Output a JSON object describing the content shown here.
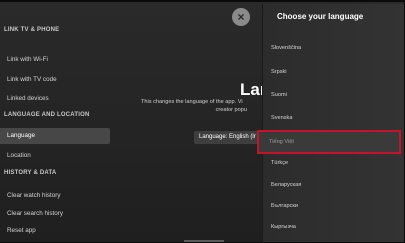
{
  "sidebar": {
    "items": [
      {
        "label": "LINK TV & PHONE",
        "type": "header"
      },
      {
        "label": "Link with Wi-Fi",
        "type": "item"
      },
      {
        "label": "Link with TV code",
        "type": "item"
      },
      {
        "label": "Linked devices",
        "type": "item"
      },
      {
        "label": "LANGUAGE AND LOCATION",
        "type": "header"
      },
      {
        "label": "Language",
        "type": "item",
        "active": true
      },
      {
        "label": "Location",
        "type": "item"
      },
      {
        "label": "HISTORY & DATA",
        "type": "header"
      },
      {
        "label": "Clear watch history",
        "type": "item"
      },
      {
        "label": "Clear search history",
        "type": "item"
      },
      {
        "label": "Reset app",
        "type": "item"
      }
    ]
  },
  "close_button": {
    "icon": "close-icon",
    "glyph": "×"
  },
  "main": {
    "title": "Lan",
    "description_line1": "This changes the language of the app. Vi",
    "description_line2": "creator popu",
    "language_button_label": "Language: English (lr"
  },
  "panel": {
    "title": "Choose your language",
    "languages": [
      "Slovenščina",
      "Srpski",
      "Suomi",
      "Svenska"
    ],
    "selected_language": "Tiếng Việt",
    "languages_after": [
      "Türkçe",
      "Беларуская",
      "Български",
      "Кыргызча"
    ]
  },
  "colors": {
    "selection_border": "#c4142a",
    "active_item_bg": "#474747"
  }
}
